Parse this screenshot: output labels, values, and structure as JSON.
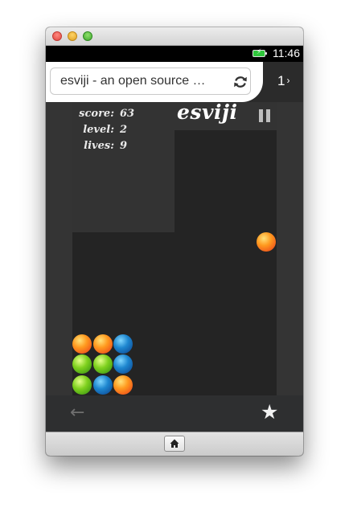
{
  "window": {
    "title": ""
  },
  "statusbar": {
    "time": "11:46",
    "battery_icon": "battery-charging-icon",
    "battery_color": "#2fc63b"
  },
  "browser": {
    "url_text": "esviji - an open source …",
    "reload_icon": "reload-icon",
    "tab_count": "1",
    "tab_chevron": "›"
  },
  "game": {
    "logo": "esviji",
    "hud": [
      {
        "label": "score:",
        "value": "63"
      },
      {
        "label": "level:",
        "value": "2"
      },
      {
        "label": "lives:",
        "value": "9"
      }
    ],
    "pause_icon": "pause-icon",
    "falling_ball": {
      "color": "orange"
    },
    "grid": [
      [
        "orange",
        "orange",
        "blue"
      ],
      [
        "green",
        "green",
        "blue"
      ],
      [
        "green",
        "blue",
        "orange"
      ]
    ],
    "colors": {
      "orange": "#ff9a1f",
      "green": "#7fd11e",
      "blue": "#1d86cf",
      "board": "#242424",
      "steps": "#333333"
    }
  },
  "navbar": {
    "back_icon": "back-arrow-icon",
    "back_glyph": "←",
    "bookmark_icon": "star-icon",
    "bookmark_glyph": "★"
  },
  "homebar": {
    "home_icon": "home-icon"
  }
}
